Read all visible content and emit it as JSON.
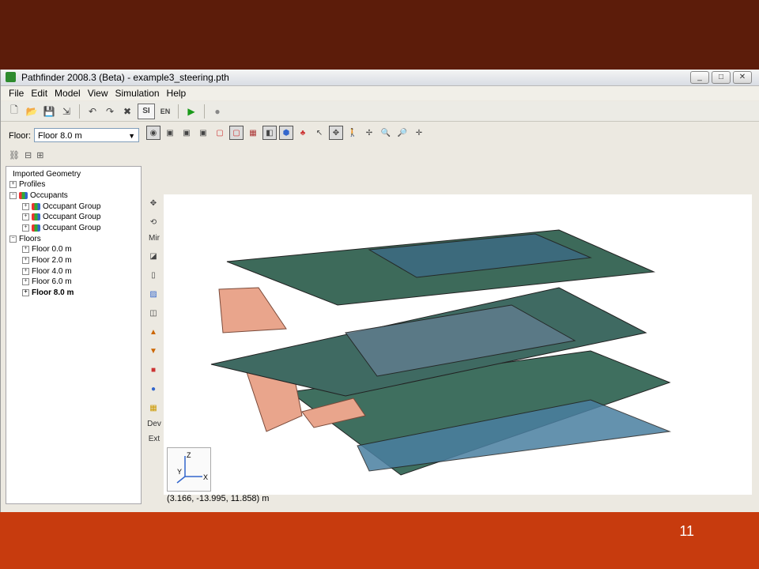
{
  "app": {
    "title": "Pathfinder 2008.3 (Beta) - example3_steering.pth",
    "window_buttons": [
      "_",
      "□",
      "✕"
    ]
  },
  "menu": [
    "File",
    "Edit",
    "Model",
    "View",
    "Simulation",
    "Help"
  ],
  "toolbar": {
    "si_label": "SI",
    "en_label": "EN"
  },
  "floor_selector": {
    "label": "Floor:",
    "value": "Floor 8.0 m"
  },
  "tree": {
    "root_items": [
      {
        "label": "Imported Geometry"
      },
      {
        "label": "Profiles"
      },
      {
        "label": "Occupants"
      },
      {
        "label": "Floors"
      }
    ],
    "occupant_groups": [
      "Occupant Group",
      "Occupant Group",
      "Occupant Group"
    ],
    "floors": [
      "Floor 0.0 m",
      "Floor 2.0 m",
      "Floor 4.0 m",
      "Floor 6.0 m",
      "Floor 8.0 m"
    ]
  },
  "side_tools": {
    "mir_label": "Mir",
    "dev_label": "Dev",
    "ext_label": "Ext"
  },
  "axes": {
    "x": "X",
    "y": "Y",
    "z": "Z"
  },
  "status": {
    "coordinates": "(3.166, -13.995, 11.858) m"
  },
  "slide": {
    "number": "11"
  },
  "colors": {
    "top_band": "#5c1c0a",
    "bottom_band": "#c73b0e"
  }
}
